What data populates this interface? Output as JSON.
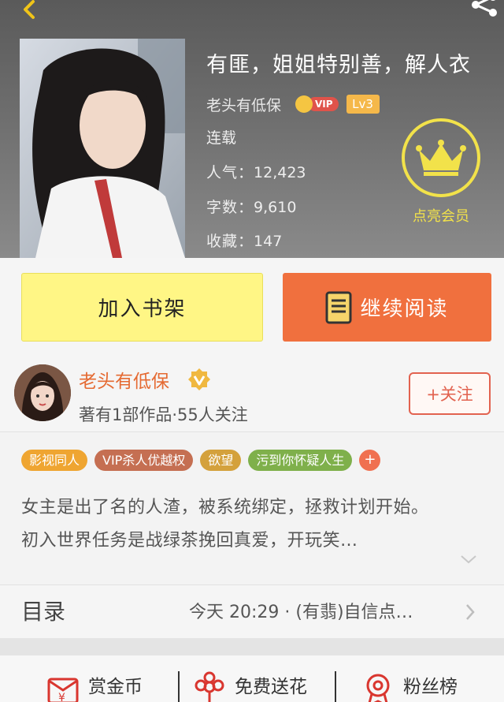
{
  "book": {
    "title": "有匪，姐姐特别善，解人衣",
    "author": "老头有低保",
    "vip_label": "VIP",
    "level": "Lv3",
    "status": "连载",
    "popularity_label": "人气：",
    "popularity": "12,423",
    "words_label": "字数：",
    "words": "9,610",
    "favorites_label": "收藏：",
    "favorites": "147"
  },
  "member": {
    "label": "点亮会员"
  },
  "actions": {
    "add_shelf": "加入书架",
    "continue_read": "继续阅读"
  },
  "author": {
    "name": "老头有低保",
    "meta": "著有1部作品·55人关注",
    "follow": "+关注"
  },
  "tags": [
    {
      "label": "影视同人",
      "color": "#efa531"
    },
    {
      "label": "VIP杀人优越权",
      "color": "#c56f52"
    },
    {
      "label": "欲望",
      "color": "#d4a13c"
    },
    {
      "label": "污到你怀疑人生",
      "color": "#7fb04b"
    }
  ],
  "tag_add": "+",
  "description": {
    "line1": "女主是出了名的人渣，被系统绑定，拯救计划开始。",
    "line2": "初入世界任务是战绿茶挽回真爱，开玩笑…"
  },
  "catalog": {
    "label": "目录",
    "latest": "今天 20:29 · (有翡)自信点…"
  },
  "features": {
    "reward": "赏金币",
    "flower": "免费送花",
    "fans": "粉丝榜"
  },
  "colors": {
    "accent_orange": "#f0703e",
    "shelf_yellow": "#fff685",
    "author_orange": "#e56a32",
    "member_yellow": "#f2e24a"
  }
}
